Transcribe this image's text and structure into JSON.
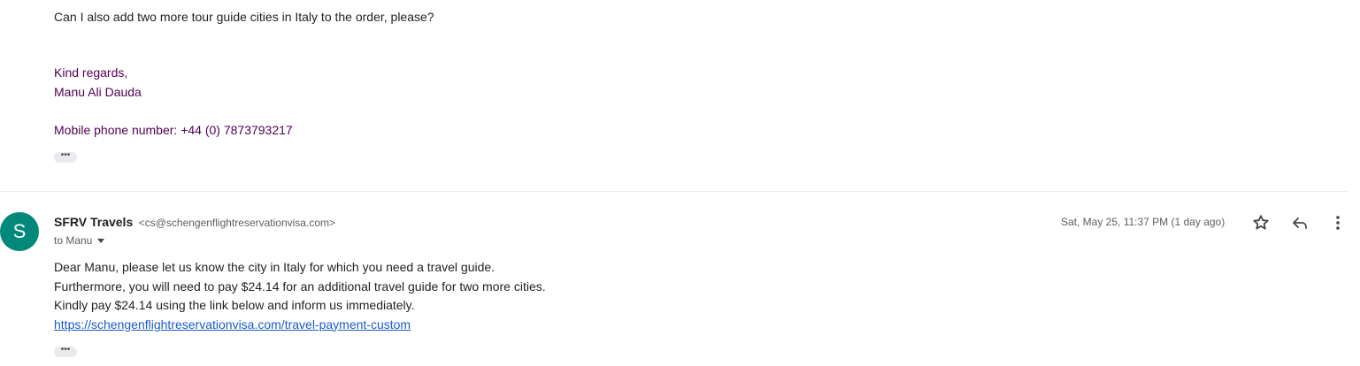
{
  "previous_message": {
    "question": "Can I also add two more tour guide cities in Italy to the order, please?",
    "signature": {
      "closing": "Kind regards,",
      "name": "Manu Ali Dauda",
      "phone": "Mobile phone number: +44 (0) 7873793217"
    },
    "show_trimmed": "•••"
  },
  "message": {
    "avatar_letter": "S",
    "avatar_color": "#00897b",
    "sender_name": "SFRV Travels",
    "sender_email": "<cs@schengenflightreservationvisa.com>",
    "recipient": "to Manu",
    "timestamp": "Sat, May 25, 11:37 PM (1 day ago)",
    "body_lines": [
      "Dear Manu, please let us know the city in Italy for which you need a travel guide.",
      "Furthermore, you will need to pay $24.14 for an additional travel guide for two more cities.",
      "Kindly pay $24.14 using the link below and inform us immediately."
    ],
    "link": "https://schengenflightreservationvisa.com/travel-payment-custom",
    "show_trimmed": "•••"
  },
  "icons": {
    "star": "star-icon",
    "reply": "reply-icon",
    "more": "more-vert-icon"
  }
}
